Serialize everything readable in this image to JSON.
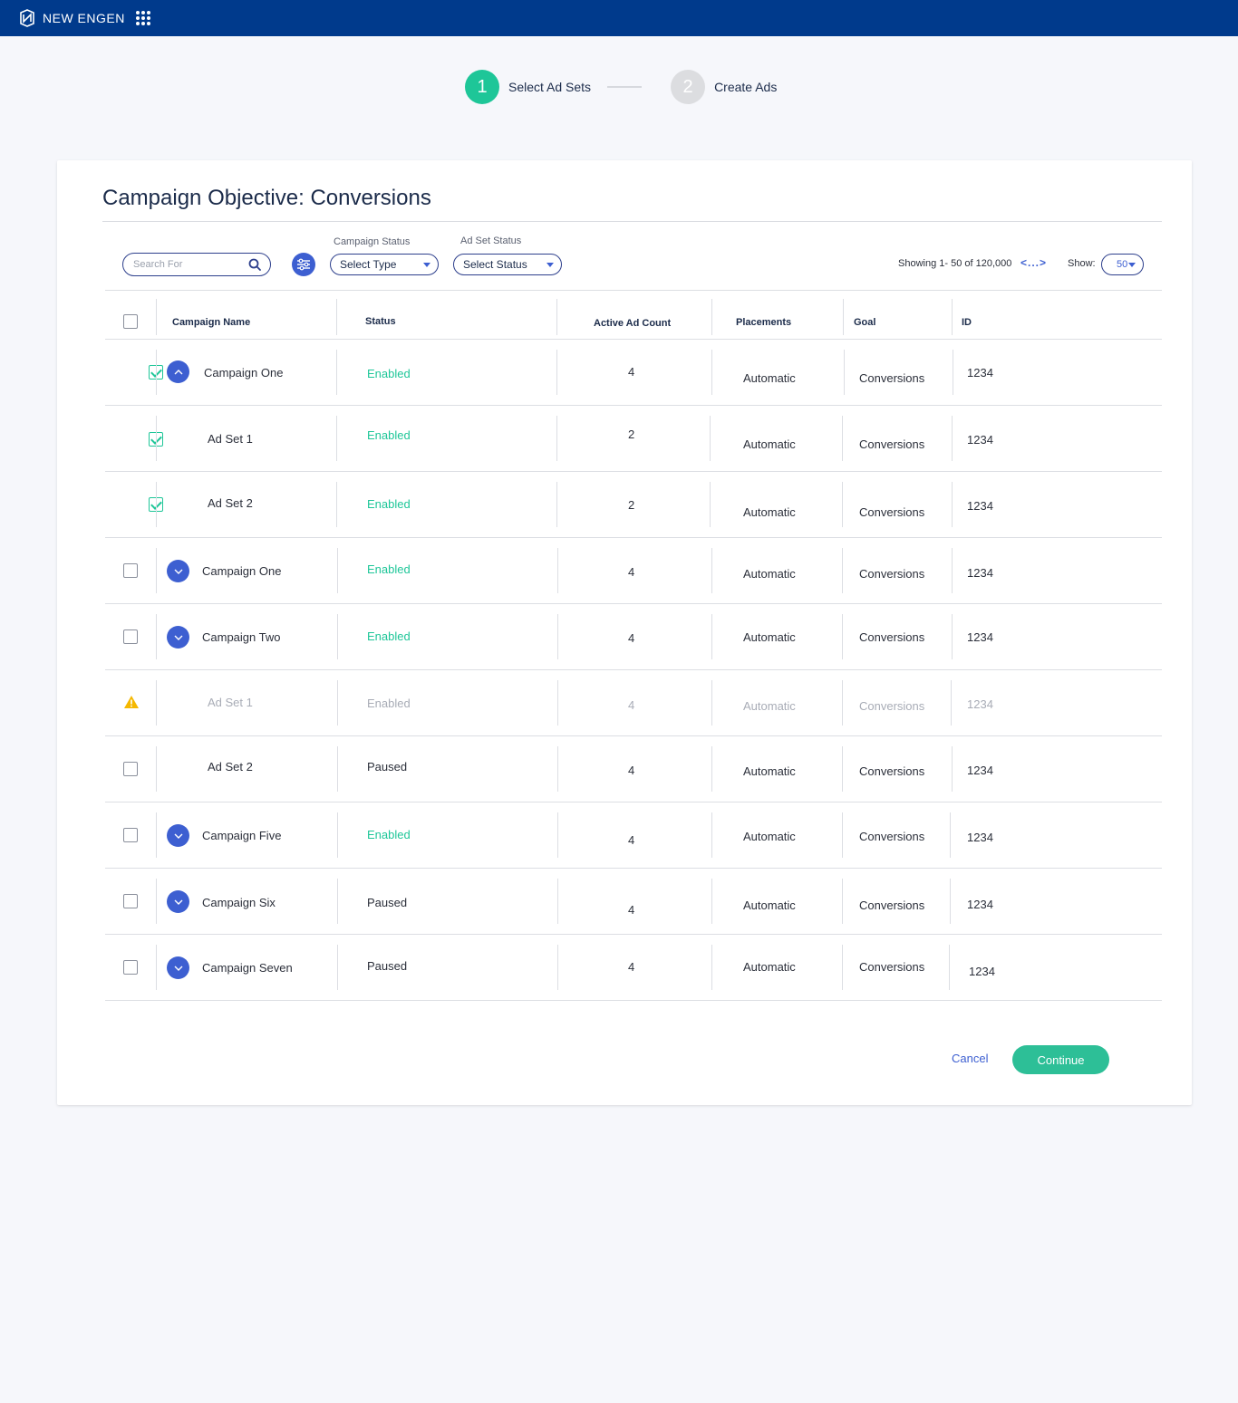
{
  "app": {
    "brand": "NEW ENGEN"
  },
  "stepper": {
    "steps": [
      {
        "number": "1",
        "label": "Select Ad Sets",
        "active": true
      },
      {
        "number": "2",
        "label": "Create Ads",
        "active": false
      }
    ]
  },
  "card": {
    "title": "Campaign Objective: Conversions"
  },
  "filters": {
    "search_placeholder": "Search For",
    "campaign_status_label": "Campaign Status",
    "campaign_status_value": "Select Type",
    "adset_status_label": "Ad Set Status",
    "adset_status_value": "Select Status",
    "showing": "Showing 1- 50 of 120,000",
    "pager": "<...>",
    "show_label": "Show:",
    "show_value": "50"
  },
  "table": {
    "headers": [
      "Campaign Name",
      "Status",
      "Active Ad Count",
      "Placements",
      "Goal",
      "ID"
    ],
    "rows": [
      {
        "name": "Campaign One",
        "status": "Enabled",
        "count": "4",
        "placement": "Automatic",
        "goal": "Conversions",
        "id": "1234"
      },
      {
        "name": "Ad Set 1",
        "status": "Enabled",
        "count": "2",
        "placement": "Automatic",
        "goal": "Conversions",
        "id": "1234"
      },
      {
        "name": "Ad Set 2",
        "status": "Enabled",
        "count": "2",
        "placement": "Automatic",
        "goal": "Conversions",
        "id": "1234"
      },
      {
        "name": "Campaign One",
        "status": "Enabled",
        "count": "4",
        "placement": "Automatic",
        "goal": "Conversions",
        "id": "1234"
      },
      {
        "name": "Campaign Two",
        "status": "Enabled",
        "count": "4",
        "placement": "Automatic",
        "goal": "Conversions",
        "id": "1234"
      },
      {
        "name": "Ad Set 1",
        "status": "Enabled",
        "count": "4",
        "placement": "Automatic",
        "goal": "Conversions",
        "id": "1234"
      },
      {
        "name": "Ad Set 2",
        "status": "Paused",
        "count": "4",
        "placement": "Automatic",
        "goal": "Conversions",
        "id": "1234"
      },
      {
        "name": "Campaign Five",
        "status": "Enabled",
        "count": "4",
        "placement": "Automatic",
        "goal": "Conversions",
        "id": "1234"
      },
      {
        "name": "Campaign Six",
        "status": "Paused",
        "count": "4",
        "placement": "Automatic",
        "goal": "Conversions",
        "id": "1234"
      },
      {
        "name": "Campaign Seven",
        "status": "Paused",
        "count": "4",
        "placement": "Automatic",
        "goal": "Conversions",
        "id": "1234"
      }
    ]
  },
  "actions": {
    "cancel": "Cancel",
    "continue": "Continue"
  },
  "colors": {
    "header_bg": "#003a8c",
    "accent_green": "#1ec698",
    "accent_blue": "#3d5fd1",
    "warning": "#f5b800"
  }
}
